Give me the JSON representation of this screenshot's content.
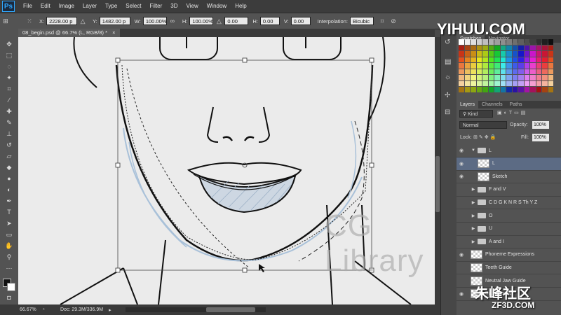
{
  "app": {
    "logo": "Ps"
  },
  "menu": [
    "File",
    "Edit",
    "Image",
    "Layer",
    "Type",
    "Select",
    "Filter",
    "3D",
    "View",
    "Window",
    "Help"
  ],
  "options": {
    "x_label": "X:",
    "x_value": "2228.00 p",
    "y_label": "Y:",
    "y_value": "1482.00 p",
    "w_label": "W:",
    "w_value": "100.00%",
    "h_label": "H:",
    "h_value": "100.00%",
    "rot_value": "0.00",
    "hskew_label": "H:",
    "hskew_value": "0.00",
    "vskew_label": "V:",
    "vskew_value": "0.00",
    "interp_label": "Interpolation:",
    "interp_value": "Bicubic"
  },
  "document": {
    "tab_title": "08_begin.psd @ 66.7% (L, RGB/8) *",
    "close": "×"
  },
  "status": {
    "zoom": "66.67%",
    "doc": "Doc: 29.3M/336.9M"
  },
  "panels": {
    "swatches_tabs": [
      "Swatches",
      "Navigator"
    ],
    "layers_tabs": [
      "Layers",
      "Channels",
      "Paths"
    ],
    "kind_label": "Kind",
    "blend_mode": "Normal",
    "opacity_label": "Opacity:",
    "opacity_value": "100%",
    "lock_label": "Lock:",
    "fill_label": "Fill:",
    "fill_value": "100%",
    "layers": [
      {
        "name": "L",
        "type": "group",
        "visible": true,
        "open": true
      },
      {
        "name": "L",
        "type": "layer",
        "visible": true,
        "selected": true
      },
      {
        "name": "Sketch",
        "type": "layer",
        "visible": true
      },
      {
        "name": "F and V",
        "type": "group",
        "visible": false
      },
      {
        "name": "C D G K N R S Th Y Z",
        "type": "group",
        "visible": false
      },
      {
        "name": "O",
        "type": "group",
        "visible": false
      },
      {
        "name": "U",
        "type": "group",
        "visible": false
      },
      {
        "name": "A and I",
        "type": "group",
        "visible": false
      },
      {
        "name": "Phoneme Expressions",
        "type": "layer",
        "visible": true
      },
      {
        "name": "Teeth Guide",
        "type": "layer",
        "visible": false
      },
      {
        "name": "Neutral Jaw Guide",
        "type": "layer",
        "visible": false
      },
      {
        "name": "Background",
        "type": "layer",
        "visible": true
      }
    ]
  },
  "watermarks": {
    "cg": "CG Library",
    "site1": "YIHUU.COM",
    "site2": "朱峰社区",
    "site3": "ZF3D.COM"
  }
}
